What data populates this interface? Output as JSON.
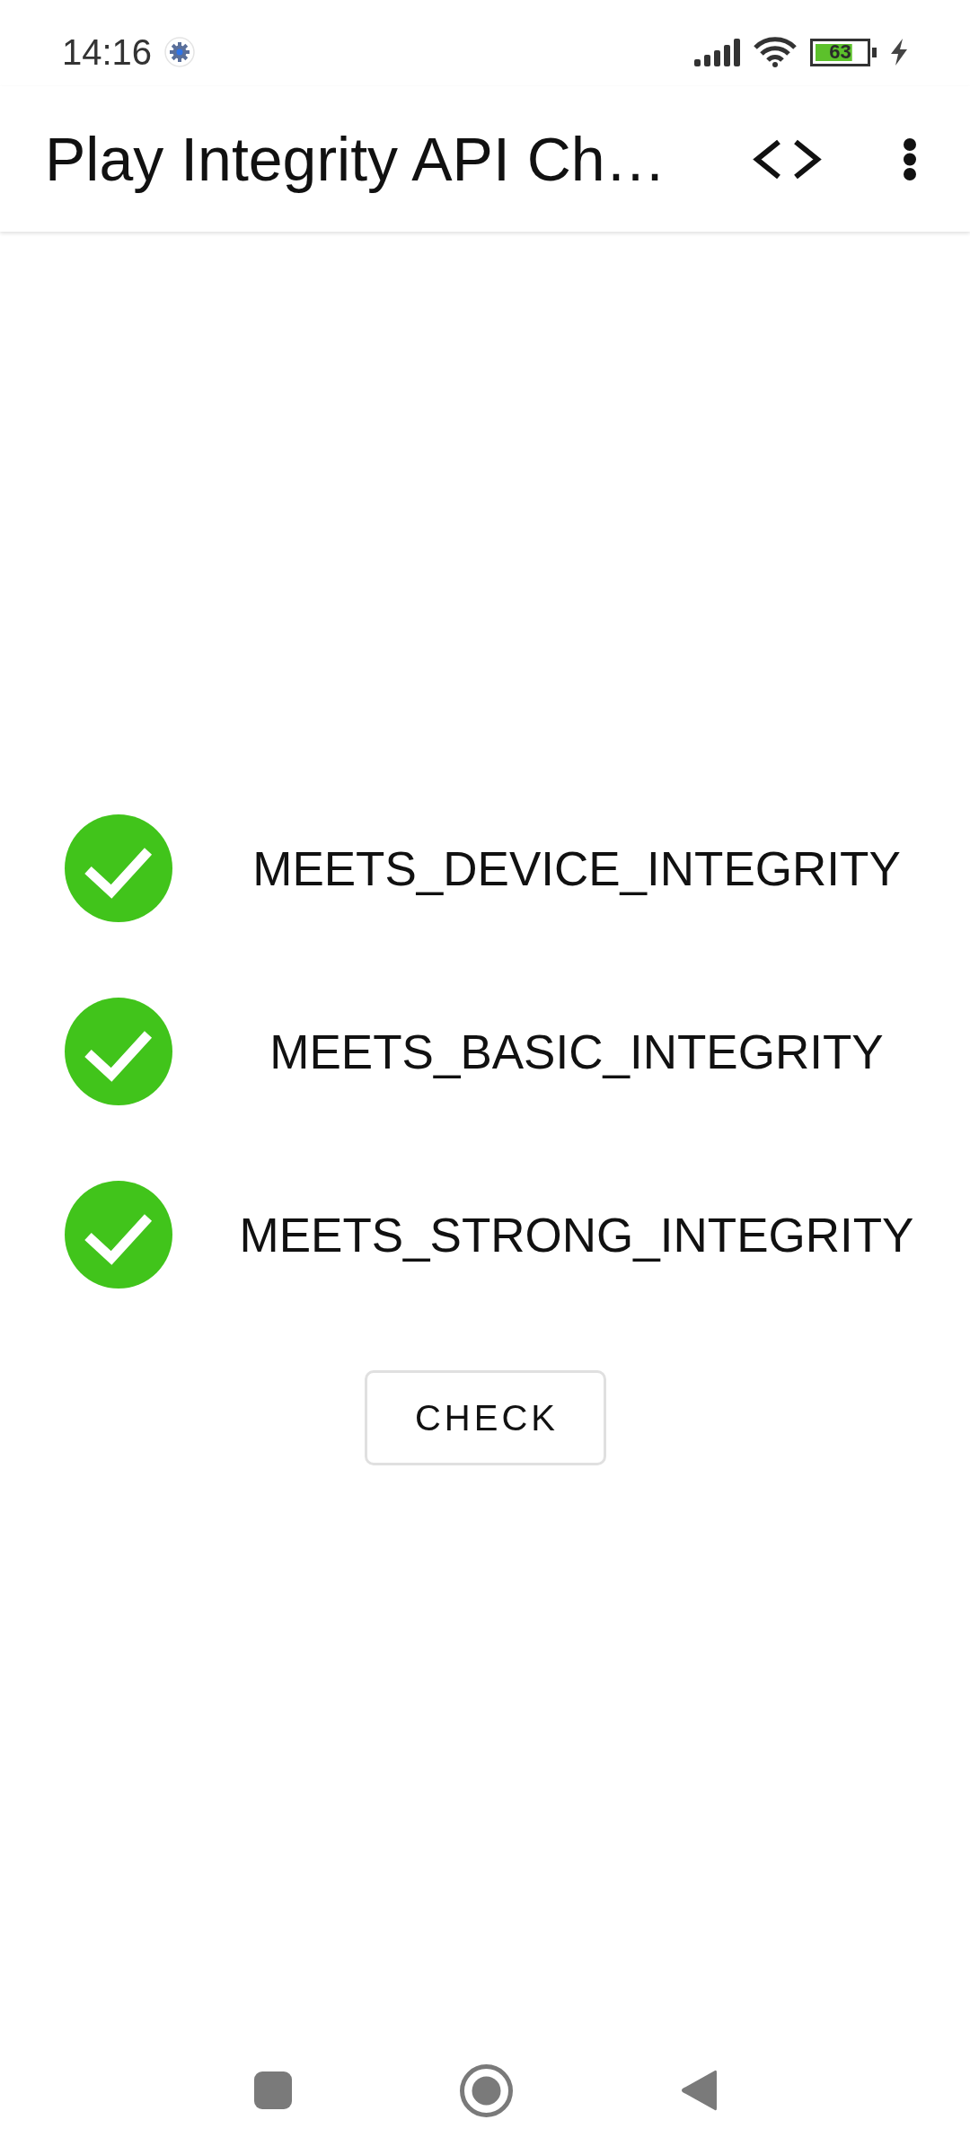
{
  "status_bar": {
    "time": "14:16",
    "battery": "63"
  },
  "toolbar": {
    "title": "Play Integrity API Ch…"
  },
  "checks": [
    {
      "label": "MEETS_DEVICE_INTEGRITY",
      "passed": true
    },
    {
      "label": "MEETS_BASIC_INTEGRITY",
      "passed": true
    },
    {
      "label": "MEETS_STRONG_INTEGRITY",
      "passed": true
    }
  ],
  "check_button": {
    "label": "CHECK"
  }
}
